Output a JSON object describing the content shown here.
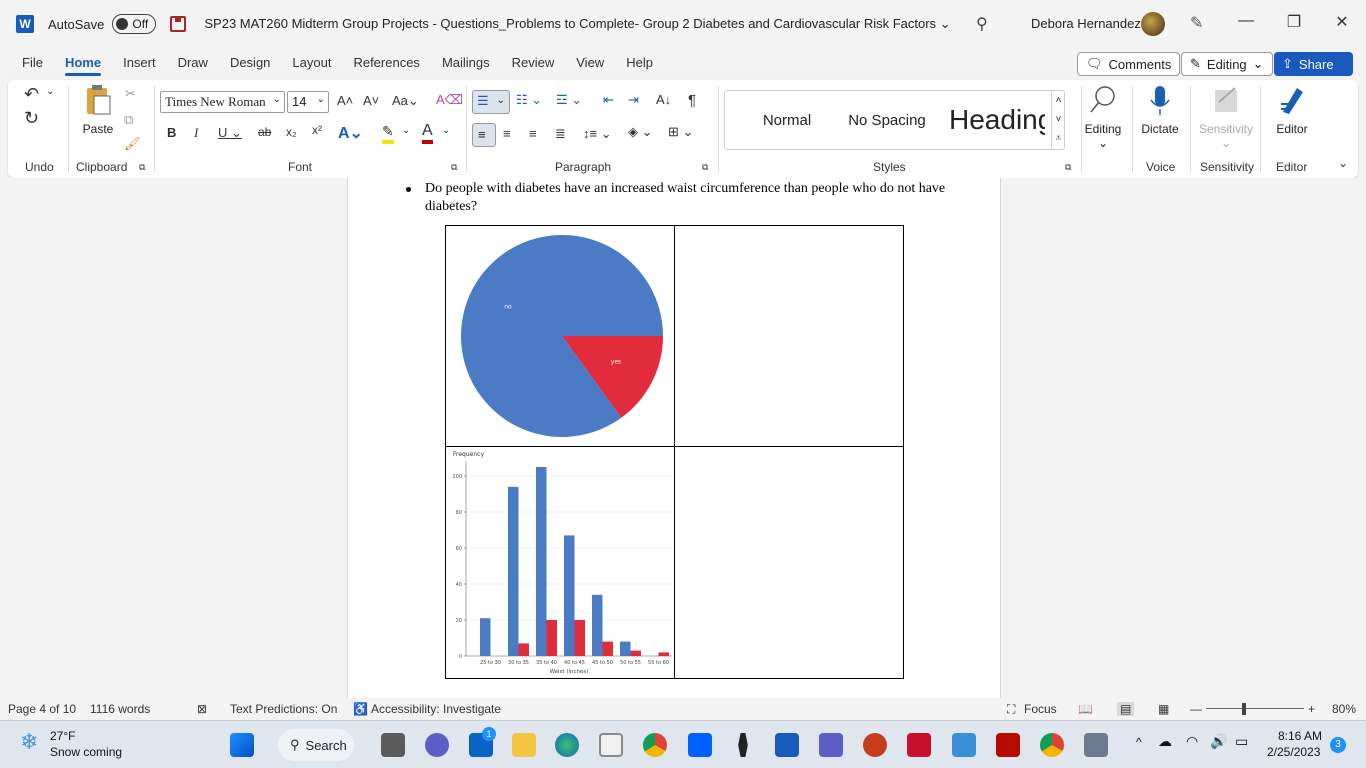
{
  "titlebar": {
    "app_logo": "W",
    "autosave_label": "AutoSave",
    "autosave_state": "Off",
    "doc_title": "SP23 MAT260 Midterm Group Projects - Questions_Problems to Complete- Group 2 Diabetes and Cardiovascular Risk Factors",
    "user_name": "Debora Hernandez"
  },
  "tabs": [
    "File",
    "Home",
    "Insert",
    "Draw",
    "Design",
    "Layout",
    "References",
    "Mailings",
    "Review",
    "View",
    "Help"
  ],
  "actions": {
    "comments": "Comments",
    "editing": "Editing",
    "share": "Share"
  },
  "ribbon": {
    "groups": {
      "undo": "Undo",
      "clipboard": "Clipboard",
      "font": "Font",
      "paragraph": "Paragraph",
      "styles": "Styles",
      "voice": "Voice",
      "sensitivity": "Sensitivity",
      "editor": "Editor"
    },
    "paste": "Paste",
    "font_name": "Times New Roman",
    "font_size": "14",
    "styles": [
      "Normal",
      "No Spacing",
      "Heading"
    ],
    "editing_btn": "Editing",
    "dictate_btn": "Dictate",
    "sensitivity_btn": "Sensitivity",
    "editor_btn": "Editor"
  },
  "document": {
    "bullet": "Do people with diabetes have an increased waist circumference than people who do not have diabetes?"
  },
  "chart_data": [
    {
      "type": "pie",
      "categories": [
        "no",
        "yes"
      ],
      "values": [
        85,
        15
      ],
      "colors": [
        "#4a7bc4",
        "#e22b3c"
      ]
    },
    {
      "type": "bar",
      "ylabel": "Frequency",
      "xlabel": "Waist (inches)",
      "categories": [
        "25 to 30",
        "30 to 35",
        "35 to 40",
        "40 to 45",
        "45 to 50",
        "50 to 55",
        "55 to 60"
      ],
      "series": [
        {
          "values": [
            21,
            94,
            105,
            67,
            34,
            8,
            0
          ],
          "color": "#4a7bc4"
        },
        {
          "values": [
            0,
            7,
            20,
            20,
            8,
            3,
            2
          ],
          "color": "#e22b3c"
        }
      ],
      "ylim": [
        0,
        105
      ],
      "yticks": [
        "0",
        "20",
        "40",
        "60",
        "80",
        "100"
      ],
      "grid": true
    }
  ],
  "statusbar": {
    "page": "Page 4 of 10",
    "words": "1116 words",
    "predictions": "Text Predictions: On",
    "accessibility": "Accessibility: Investigate",
    "focus": "Focus",
    "zoom": "80%"
  },
  "taskbar": {
    "weather_temp": "27°F",
    "weather_desc": "Snow coming",
    "search": "Search",
    "time": "8:16 AM",
    "date": "2/25/2023",
    "notification_count": "3"
  }
}
